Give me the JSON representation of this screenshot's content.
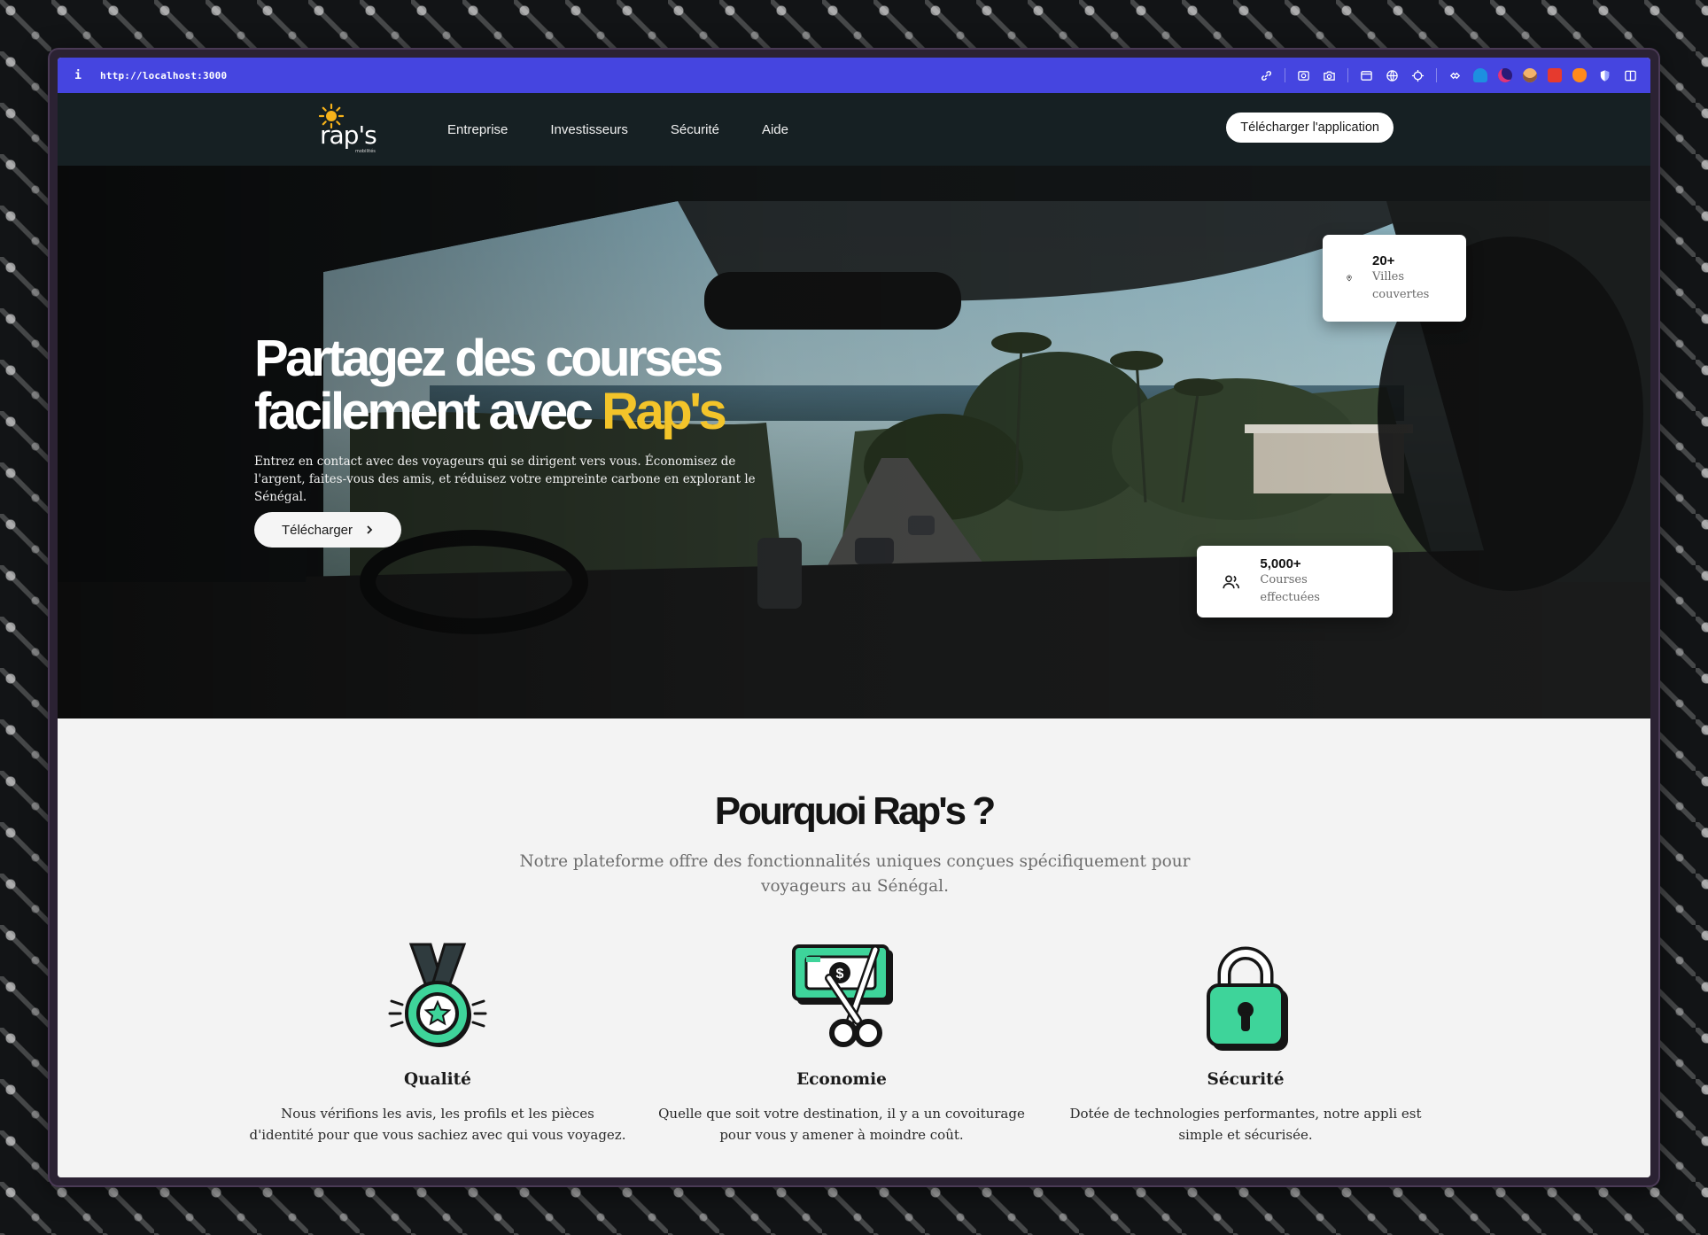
{
  "browser": {
    "info_glyph": "i",
    "url": "http://localhost:3000",
    "toolbar_icons": [
      "link-icon",
      "screenshot-icon",
      "camera-icon",
      "window-icon",
      "globe-icon",
      "crosshair-icon",
      "extensions-icon",
      "ext-blue-icon",
      "ext-purple-icon",
      "ext-avatar-icon",
      "ext-red-icon",
      "ext-orange-icon",
      "shield-icon",
      "sidebar-icon"
    ]
  },
  "nav": {
    "logo_text": "rap's",
    "logo_subtext": "mobilités",
    "links": [
      "Entreprise",
      "Investisseurs",
      "Sécurité",
      "Aide"
    ],
    "cta": "Télécharger l'application"
  },
  "hero": {
    "title_line1": "Partagez des courses",
    "title_line2_prefix": "facilement avec ",
    "title_accent": "Rap's",
    "subtitle": "Entrez en contact avec des voyageurs qui se dirigent vers vous. Économisez de l'argent, faites-vous des amis, et réduisez votre empreinte carbone en explorant le Sénégal.",
    "button": "Télécharger",
    "button_icon": "chevron-right-icon",
    "stats": [
      {
        "value": "20+",
        "label": "Villes couvertes",
        "icon": "map-pin-icon"
      },
      {
        "value": "5,000+",
        "label": "Courses effectuées",
        "icon": "users-icon"
      }
    ]
  },
  "features": {
    "title": "Pourquoi Rap's ?",
    "subtitle": "Notre plateforme offre des fonctionnalités uniques conçues spécifiquement pour voyageurs au Sénégal.",
    "items": [
      {
        "name": "Qualité",
        "desc": "Nous vérifions les avis, les profils et les pièces d'identité pour que vous sachiez avec qui vous voyagez.",
        "icon": "medal-icon"
      },
      {
        "name": "Economie",
        "desc": "Quelle que soit votre destination, il y a un covoiturage pour vous y amener à moindre coût.",
        "icon": "cut-price-icon"
      },
      {
        "name": "Sécurité",
        "desc": "Dotée de technologies performantes, notre appli est simple et sécurisée.",
        "icon": "padlock-icon"
      }
    ]
  },
  "colors": {
    "urlbar": "#4545e0",
    "nav_bg": "#162023",
    "accent_yellow": "#f3c42a",
    "icon_green": "#3ed49a"
  }
}
